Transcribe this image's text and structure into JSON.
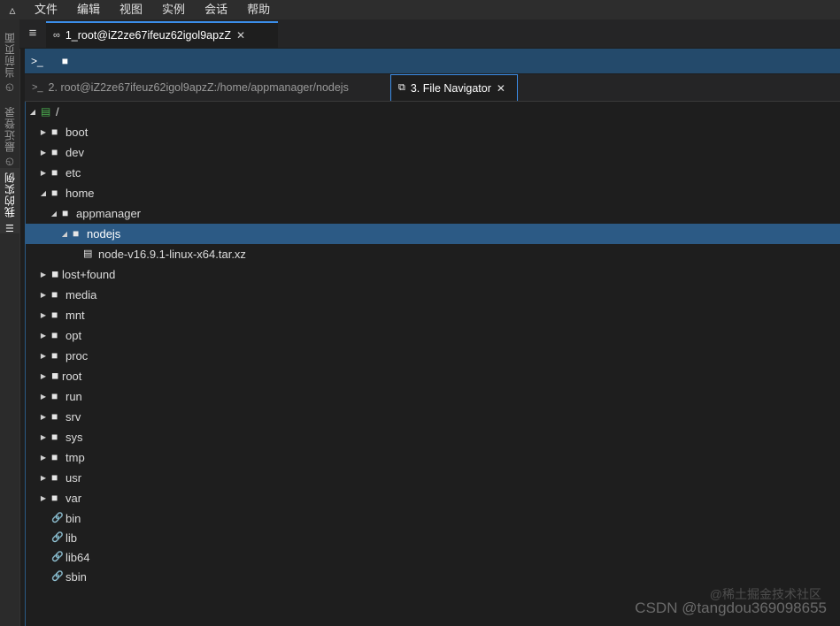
{
  "menubar": {
    "items": [
      "文件",
      "编辑",
      "视图",
      "实例",
      "会话",
      "帮助"
    ]
  },
  "sidebar": {
    "tabs": [
      {
        "label": "当前页面",
        "icon": "clock-icon"
      },
      {
        "label": "最近登录",
        "icon": "clock-icon"
      },
      {
        "label": "我的实例",
        "icon": "list-icon"
      }
    ]
  },
  "doc_tab": {
    "label": "1_root@iZ2ze67ifeuz62igol9apzZ"
  },
  "toolbar": {
    "items": [
      "terminal-icon",
      "folder-icon"
    ]
  },
  "subtabs": [
    {
      "label": "2. root@iZ2ze67ifeuz62igol9apzZ:/home/appmanager/nodejs"
    },
    {
      "label": "3. File Navigator"
    }
  ],
  "tree": {
    "root_label": "/",
    "items": [
      {
        "label": "boot",
        "type": "folder"
      },
      {
        "label": "dev",
        "type": "folder"
      },
      {
        "label": "etc",
        "type": "folder"
      },
      {
        "label": "home",
        "type": "folder-open"
      },
      {
        "label": "appmanager",
        "type": "folder-open"
      },
      {
        "label": "nodejs",
        "type": "folder-open"
      },
      {
        "label": "node-v16.9.1-linux-x64.tar.xz",
        "type": "file"
      },
      {
        "label": "lost+found",
        "type": "locked"
      },
      {
        "label": "media",
        "type": "folder"
      },
      {
        "label": "mnt",
        "type": "folder"
      },
      {
        "label": "opt",
        "type": "folder"
      },
      {
        "label": "proc",
        "type": "folder"
      },
      {
        "label": "root",
        "type": "locked"
      },
      {
        "label": "run",
        "type": "folder"
      },
      {
        "label": "srv",
        "type": "folder"
      },
      {
        "label": "sys",
        "type": "folder"
      },
      {
        "label": "tmp",
        "type": "folder"
      },
      {
        "label": "usr",
        "type": "folder"
      },
      {
        "label": "var",
        "type": "folder"
      },
      {
        "label": "bin",
        "type": "link"
      },
      {
        "label": "lib",
        "type": "link"
      },
      {
        "label": "lib64",
        "type": "link"
      },
      {
        "label": "sbin",
        "type": "link"
      }
    ]
  },
  "watermark": {
    "csdn": "CSDN @tangdou369098655",
    "juejin": "@稀土掘金技术社区"
  }
}
